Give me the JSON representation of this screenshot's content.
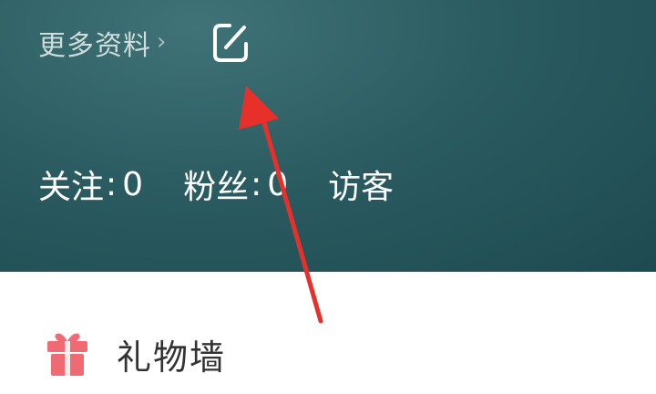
{
  "header": {
    "more_info": {
      "label": "更多资料",
      "chevron": "›"
    },
    "edit_icon": "edit-icon"
  },
  "stats": {
    "following": {
      "label": "关注",
      "colon": ":",
      "value": "0"
    },
    "followers": {
      "label": "粉丝",
      "colon": ":",
      "value": "0"
    },
    "visitors": {
      "label": "访客"
    }
  },
  "menu": {
    "gift_wall": {
      "icon": "gift-icon",
      "label": "礼物墙"
    }
  },
  "colors": {
    "header_bg": "#2b5c61",
    "arrow": "#e8302b",
    "gift": "#f06a73"
  }
}
